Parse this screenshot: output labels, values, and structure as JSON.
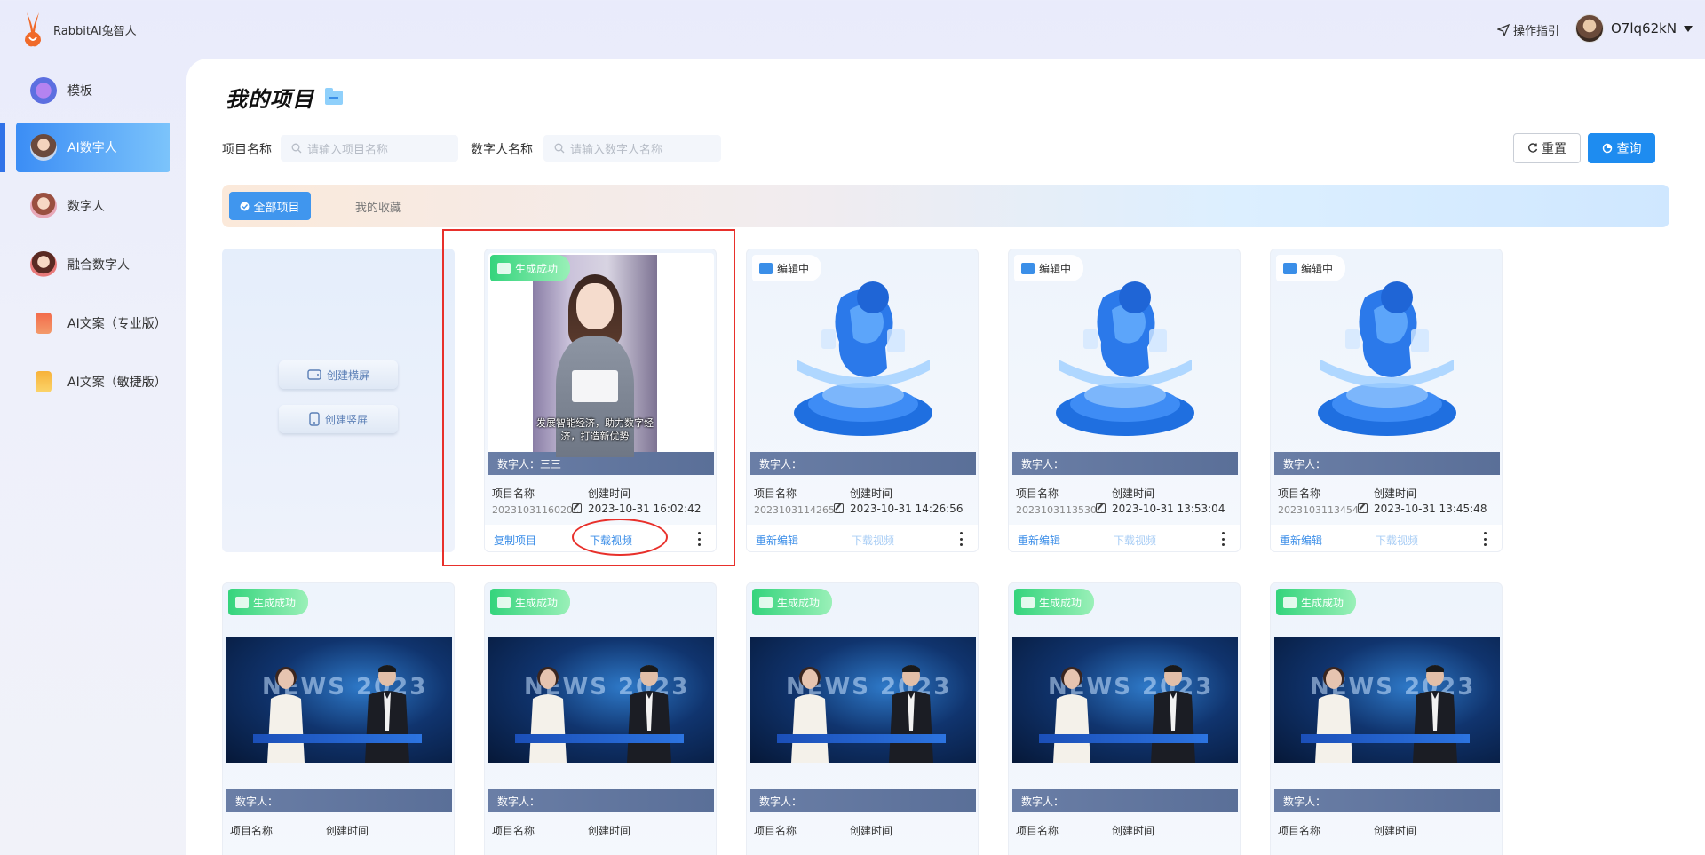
{
  "app": {
    "name": "RabbitAI兔智人"
  },
  "header": {
    "guide_label": "操作指引",
    "username": "O7lq62kN"
  },
  "sidebar": {
    "items": [
      {
        "label": "模板",
        "icon": "template-icon"
      },
      {
        "label": "AI数字人",
        "icon": "ai-avatar-icon",
        "active": true
      },
      {
        "label": "数字人",
        "icon": "digital-human-icon"
      },
      {
        "label": "融合数字人",
        "icon": "fusion-human-icon"
      },
      {
        "label": "AI文案（专业版）",
        "icon": "pro-copy-icon"
      },
      {
        "label": "AI文案（敏捷版）",
        "icon": "agile-copy-icon"
      }
    ]
  },
  "page": {
    "title": "我的项目",
    "filters": {
      "project_label": "项目名称",
      "project_placeholder": "请输入项目名称",
      "human_label": "数字人名称",
      "human_placeholder": "请输入数字人名称"
    },
    "buttons": {
      "reset": "重置",
      "query": "查询"
    },
    "tabs": {
      "all": "全部项目",
      "favorites": "我的收藏"
    },
    "create": {
      "landscape": "创建横屏",
      "portrait": "创建竖屏"
    }
  },
  "cards_row1": [
    {
      "status": "生成成功",
      "subtitle": "发展智能经济，助力数字经济，打造新优势",
      "human": "数字人：三三",
      "name_label": "项目名称",
      "time_label": "创建时间",
      "project_id": "2023103116020…",
      "created": "2023-10-31 16:02:42",
      "action_left": "复制项目",
      "action_mid": "下载视频"
    },
    {
      "status": "编辑中",
      "human": "数字人：",
      "name_label": "项目名称",
      "time_label": "创建时间",
      "project_id": "2023103114265…",
      "created": "2023-10-31 14:26:56",
      "action_left": "重新编辑",
      "action_mid": "下载视频"
    },
    {
      "status": "编辑中",
      "human": "数字人：",
      "name_label": "项目名称",
      "time_label": "创建时间",
      "project_id": "2023103113530…",
      "created": "2023-10-31 13:53:04",
      "action_left": "重新编辑",
      "action_mid": "下载视频"
    },
    {
      "status": "编辑中",
      "human": "数字人：",
      "name_label": "项目名称",
      "time_label": "创建时间",
      "project_id": "2023103113454…",
      "created": "2023-10-31 13:45:48",
      "action_left": "重新编辑",
      "action_mid": "下载视频"
    }
  ],
  "cards_row2": [
    {
      "status": "生成成功",
      "news_text": "NEWS 2023",
      "human": "数字人：",
      "name_label": "项目名称",
      "time_label": "创建时间"
    },
    {
      "status": "生成成功",
      "news_text": "NEWS 2023",
      "human": "数字人：",
      "name_label": "项目名称",
      "time_label": "创建时间"
    },
    {
      "status": "生成成功",
      "news_text": "NEWS 2023",
      "human": "数字人：",
      "name_label": "项目名称",
      "time_label": "创建时间"
    },
    {
      "status": "生成成功",
      "news_text": "NEWS 2023",
      "human": "数字人：",
      "name_label": "项目名称",
      "time_label": "创建时间"
    },
    {
      "status": "生成成功",
      "news_text": "NEWS 2023",
      "human": "数字人：",
      "name_label": "项目名称",
      "time_label": "创建时间"
    }
  ],
  "colors": {
    "accent": "#1e8cf0",
    "success": "#34d47c",
    "highlight": "#e8302b"
  }
}
